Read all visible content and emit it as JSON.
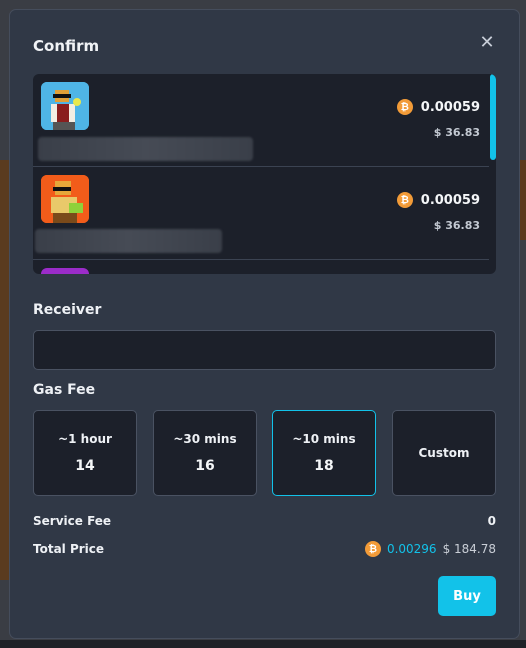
{
  "modal": {
    "title": "Confirm",
    "close_icon": "close-icon"
  },
  "items": [
    {
      "btc": "0.00059",
      "usd": "$ 36.83",
      "thumb_bg": "#4fb5e6"
    },
    {
      "btc": "0.00059",
      "usd": "$ 36.83",
      "thumb_bg": "#f25c1a"
    }
  ],
  "receiver": {
    "label": "Receiver",
    "value": "",
    "placeholder": ""
  },
  "gas_fee": {
    "label": "Gas Fee",
    "options": [
      {
        "time": "~1 hour",
        "value": "14"
      },
      {
        "time": "~30 mins",
        "value": "16"
      },
      {
        "time": "~10 mins",
        "value": "18"
      },
      {
        "time": "Custom",
        "value": ""
      }
    ],
    "selected_index": 2
  },
  "service_fee": {
    "label": "Service Fee",
    "value": "0"
  },
  "total_price": {
    "label": "Total Price",
    "btc": "0.00296",
    "usd": "$ 184.78"
  },
  "buy_button": {
    "label": "Buy"
  },
  "colors": {
    "accent": "#12c2e9",
    "bitcoin": "#f29b38",
    "modal_bg": "#303846",
    "panel_bg": "#1c202a"
  }
}
